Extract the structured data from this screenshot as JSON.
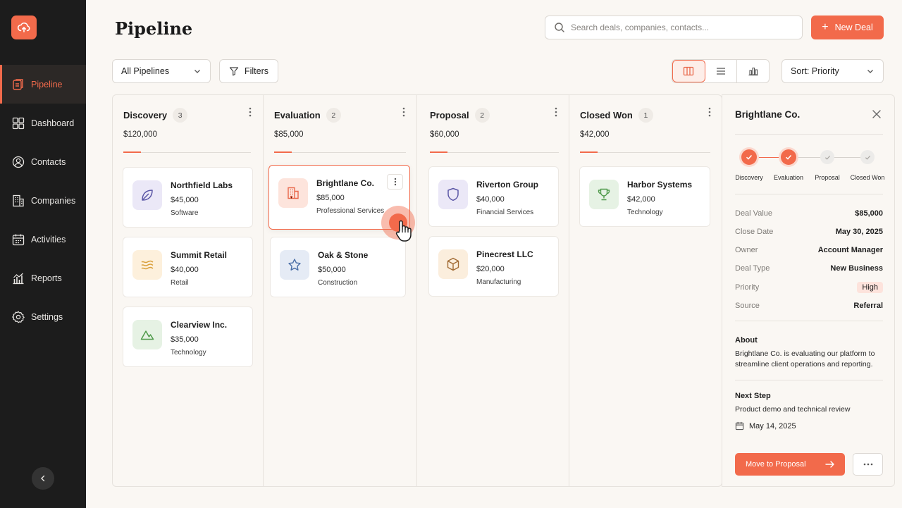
{
  "app": {
    "page_title": "Pipeline"
  },
  "sidebar": {
    "items": [
      {
        "label": "Pipeline",
        "icon": "pipeline-icon",
        "active": true
      },
      {
        "label": "Dashboard",
        "icon": "dashboard-icon"
      },
      {
        "label": "Contacts",
        "icon": "contacts-icon"
      },
      {
        "label": "Companies",
        "icon": "companies-icon"
      },
      {
        "label": "Activities",
        "icon": "calendar-icon"
      },
      {
        "label": "Reports",
        "icon": "reports-icon"
      },
      {
        "label": "Settings",
        "icon": "gear-icon"
      }
    ],
    "collapse_icon": "chevron-left-icon"
  },
  "header": {
    "search_placeholder": "Search deals, companies, contacts...",
    "new_deal_label": "New Deal"
  },
  "toolbar": {
    "pipeline_select": "All Pipelines",
    "filters_label": "Filters",
    "views": [
      "board-view-icon",
      "list-view-icon",
      "chart-view-icon"
    ],
    "active_view": "board",
    "sort_select": "Sort: Priority"
  },
  "columns": [
    {
      "name": "Discovery",
      "count": "3",
      "total": "$120,000",
      "cards": [
        {
          "name": "Northfield Labs",
          "value": "$45,000",
          "industry": "Software",
          "icon": "leaf-icon",
          "tint": "#ebe8f7",
          "stroke": "#5b57a6"
        },
        {
          "name": "Summit Retail",
          "value": "$40,000",
          "industry": "Retail",
          "icon": "waves-icon",
          "tint": "#fdf0dc",
          "stroke": "#d9a03c"
        },
        {
          "name": "Clearview Inc.",
          "value": "$35,000",
          "industry": "Technology",
          "icon": "mountain-icon",
          "tint": "#e6f2e4",
          "stroke": "#4f9a4a"
        }
      ]
    },
    {
      "name": "Evaluation",
      "count": "2",
      "total": "$85,000",
      "cards": [
        {
          "name": "Brightlane Co.",
          "value": "$85,000",
          "industry": "Professional Services",
          "icon": "building-icon",
          "tint": "#fde4dc",
          "stroke": "#e9674a"
        },
        {
          "name": "Oak & Stone",
          "value": "$50,000",
          "industry": "Construction",
          "icon": "star-icon",
          "tint": "#e5ebf5",
          "stroke": "#4a6fa8"
        }
      ]
    },
    {
      "name": "Proposal",
      "count": "2",
      "total": "$60,000",
      "cards": [
        {
          "name": "Riverton Group",
          "value": "$40,000",
          "industry": "Financial Services",
          "icon": "shield-icon",
          "tint": "#ebe8f7",
          "stroke": "#5b57a6"
        },
        {
          "name": "Pinecrest LLC",
          "value": "$20,000",
          "industry": "Manufacturing",
          "icon": "box-icon",
          "tint": "#fbeedd",
          "stroke": "#a26b34"
        }
      ]
    },
    {
      "name": "Closed Won",
      "count": "1",
      "total": "$42,000",
      "cards": [
        {
          "name": "Harbor Systems",
          "value": "$42,000",
          "industry": "Technology",
          "icon": "trophy-icon",
          "tint": "#e6f2e4",
          "stroke": "#4f9a4a"
        }
      ]
    }
  ],
  "detail": {
    "title": "Brightlane Co.",
    "stages": [
      {
        "label": "Discovery",
        "state": "done"
      },
      {
        "label": "Evaluation",
        "state": "current"
      },
      {
        "label": "Proposal",
        "state": "todo"
      },
      {
        "label": "Closed Won",
        "state": "todo"
      }
    ],
    "fields": [
      {
        "k": "Deal Value",
        "v": "$85,000"
      },
      {
        "k": "Close Date",
        "v": "May 30, 2025"
      },
      {
        "k": "Owner",
        "v": "Account Manager"
      },
      {
        "k": "Deal Type",
        "v": "New Business"
      },
      {
        "k": "Priority",
        "v": "High"
      },
      {
        "k": "Source",
        "v": "Referral"
      }
    ],
    "about_title": "About",
    "about_text": "Brightlane Co. is evaluating our platform to streamline client operations and reporting.",
    "next_step_title": "Next Step",
    "next_step_text": "Product demo and technical review",
    "next_step_date": "May 14, 2025",
    "move_label": "Move to Proposal"
  },
  "colors": {
    "accent": "#f26a4b",
    "sidebar_bg": "#1c1c1c",
    "page_bg": "#faf7f3"
  }
}
